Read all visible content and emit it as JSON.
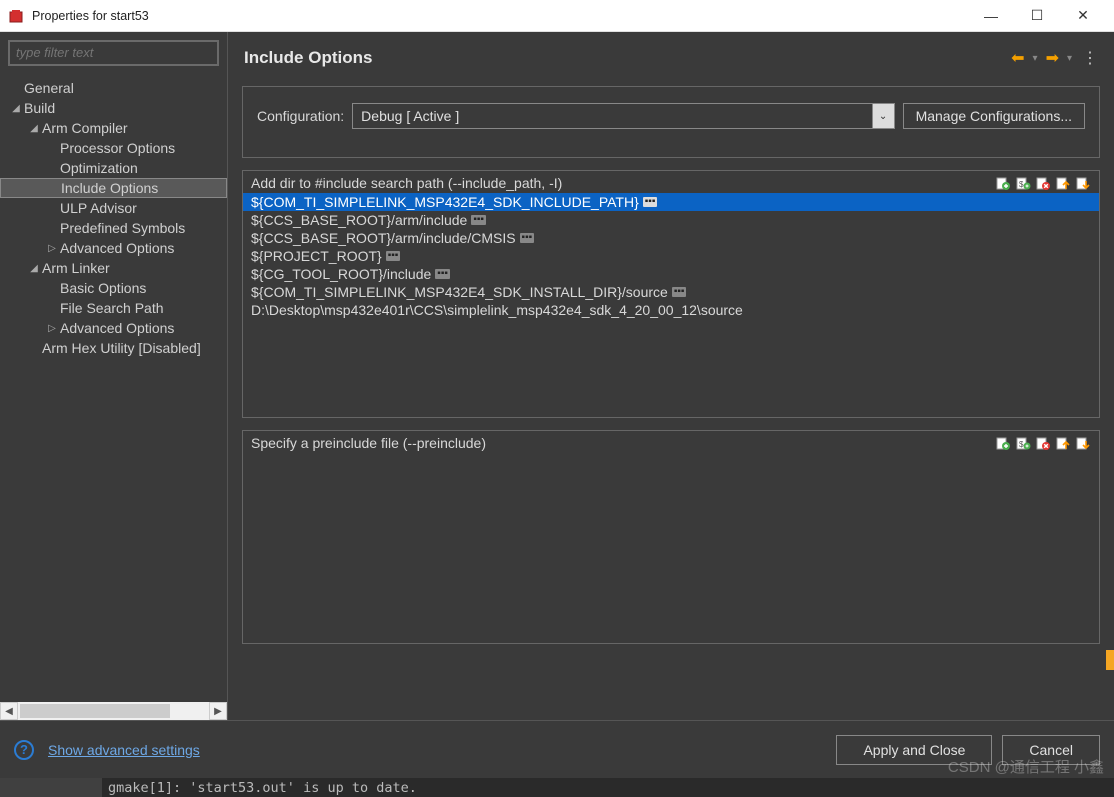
{
  "window": {
    "title": "Properties for start53"
  },
  "sidebar": {
    "filter_placeholder": "type filter text",
    "items": [
      {
        "label": "General",
        "indent": 0,
        "arrow": ""
      },
      {
        "label": "Build",
        "indent": 0,
        "arrow": "◢"
      },
      {
        "label": "Arm Compiler",
        "indent": 1,
        "arrow": "◢"
      },
      {
        "label": "Processor Options",
        "indent": 2,
        "arrow": ""
      },
      {
        "label": "Optimization",
        "indent": 2,
        "arrow": ""
      },
      {
        "label": "Include Options",
        "indent": 2,
        "arrow": "",
        "selected": true
      },
      {
        "label": "ULP Advisor",
        "indent": 2,
        "arrow": ""
      },
      {
        "label": "Predefined Symbols",
        "indent": 2,
        "arrow": ""
      },
      {
        "label": "Advanced Options",
        "indent": 2,
        "arrow": "▷"
      },
      {
        "label": "Arm Linker",
        "indent": 1,
        "arrow": "◢"
      },
      {
        "label": "Basic Options",
        "indent": 2,
        "arrow": ""
      },
      {
        "label": "File Search Path",
        "indent": 2,
        "arrow": ""
      },
      {
        "label": "Advanced Options",
        "indent": 2,
        "arrow": "▷"
      },
      {
        "label": "Arm Hex Utility  [Disabled]",
        "indent": 1,
        "arrow": ""
      }
    ]
  },
  "main": {
    "title": "Include Options",
    "config_label": "Configuration:",
    "config_value": "Debug  [ Active ]",
    "manage_label": "Manage Configurations...",
    "include_list": {
      "title": "Add dir to #include search path (--include_path, -I)",
      "items": [
        {
          "text": "${COM_TI_SIMPLELINK_MSP432E4_SDK_INCLUDE_PATH}",
          "badge": true,
          "selected": true
        },
        {
          "text": "${CCS_BASE_ROOT}/arm/include",
          "badge": true
        },
        {
          "text": "${CCS_BASE_ROOT}/arm/include/CMSIS",
          "badge": true
        },
        {
          "text": "${PROJECT_ROOT}",
          "badge": true
        },
        {
          "text": "${CG_TOOL_ROOT}/include",
          "badge": true
        },
        {
          "text": "${COM_TI_SIMPLELINK_MSP432E4_SDK_INSTALL_DIR}/source",
          "badge": true
        },
        {
          "text": "D:\\Desktop\\msp432e401r\\CCS\\simplelink_msp432e4_sdk_4_20_00_12\\source",
          "badge": false
        }
      ]
    },
    "preinclude_list": {
      "title": "Specify a preinclude file (--preinclude)",
      "items": []
    }
  },
  "footer": {
    "advanced_link": "Show advanced settings",
    "apply_label": "Apply and Close",
    "cancel_label": "Cancel"
  },
  "console": {
    "text": "gmake[1]: 'start53.out' is up to date."
  },
  "watermark": "CSDN @通信工程 小鑫",
  "icons": {
    "list_toolbar": [
      "add-icon",
      "add-variable-icon",
      "delete-icon",
      "move-up-icon",
      "move-down-icon"
    ]
  },
  "colors": {
    "selection": "#0b63c4",
    "accent_orange": "#F4A000",
    "link": "#6ea8e6"
  }
}
